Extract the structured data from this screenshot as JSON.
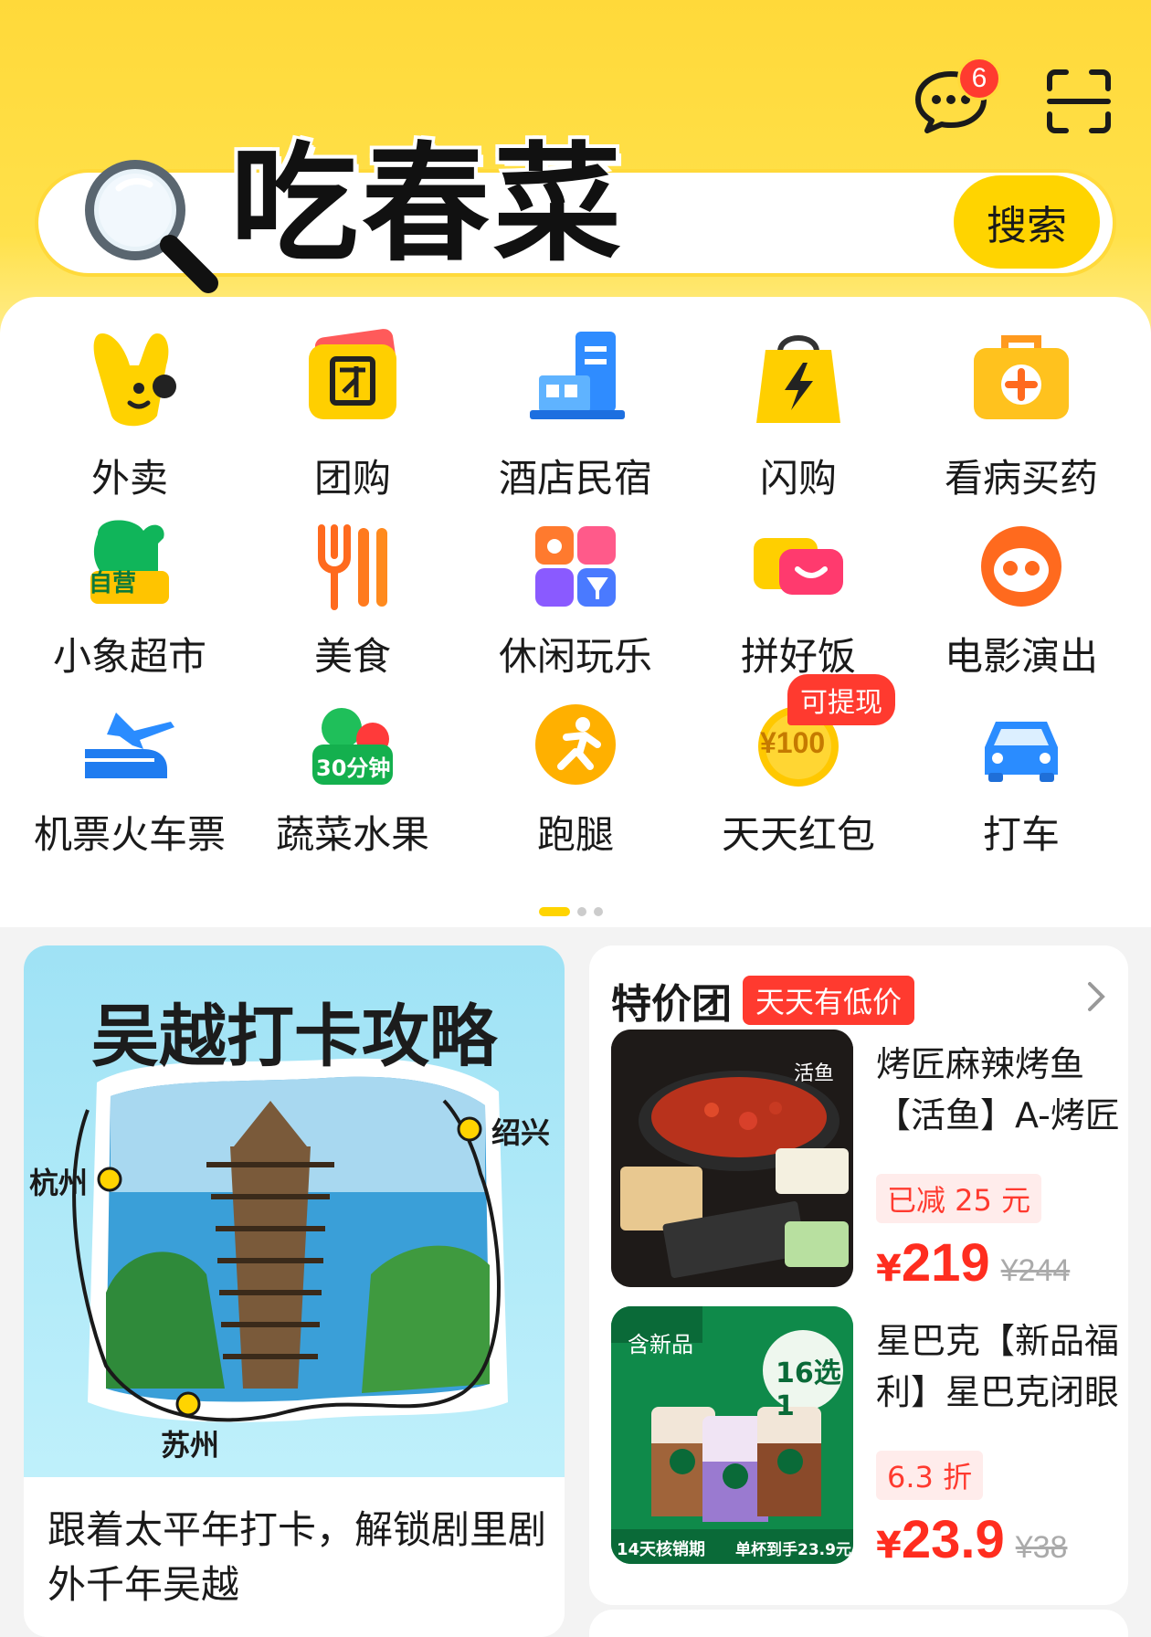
{
  "header": {
    "message_badge": "6",
    "icons": [
      "chat-icon",
      "scan-icon"
    ]
  },
  "search": {
    "query": "吃春菜",
    "button_label": "搜索"
  },
  "categories": [
    {
      "label": "外卖",
      "icon": "waimai-icon"
    },
    {
      "label": "团购",
      "icon": "tuangou-icon"
    },
    {
      "label": "酒店民宿",
      "icon": "hotel-icon"
    },
    {
      "label": "闪购",
      "icon": "flash-buy-icon"
    },
    {
      "label": "看病买药",
      "icon": "medicine-icon"
    },
    {
      "label": "小象超市",
      "icon": "elephant-market-icon",
      "sub": "自营"
    },
    {
      "label": "美食",
      "icon": "food-icon"
    },
    {
      "label": "休闲玩乐",
      "icon": "leisure-icon"
    },
    {
      "label": "拼好饭",
      "icon": "pinhaofan-icon"
    },
    {
      "label": "电影演出",
      "icon": "movie-icon"
    },
    {
      "label": "机票火车票",
      "icon": "ticket-icon"
    },
    {
      "label": "蔬菜水果",
      "icon": "vegetable-icon",
      "sub": "30分钟"
    },
    {
      "label": "跑腿",
      "icon": "errand-icon"
    },
    {
      "label": "天天红包",
      "icon": "red-packet-icon",
      "sub": "¥100",
      "tag": "可提现"
    },
    {
      "label": "打车",
      "icon": "taxi-icon"
    }
  ],
  "banner": {
    "title": "吴越打卡攻略",
    "cities": [
      "杭州",
      "绍兴",
      "苏州"
    ],
    "description": "跟着太平年打卡，解锁剧里剧外千年吴越"
  },
  "deals": {
    "title": "特价团",
    "tag": "天天有低价",
    "items": [
      {
        "name": "烤匠麻辣烤鱼【活鱼】A-烤匠",
        "discount": "已减 25 元",
        "currency": "¥",
        "price": "219",
        "old_price": "¥244",
        "thumb_tag": "活鱼"
      },
      {
        "name": "星巴克【新品福利】星巴克闭眼",
        "discount": "6.3 折",
        "currency": "¥",
        "price": "23.9",
        "old_price": "¥38",
        "thumb_tag": "含新品",
        "thumb_badge": "16选1",
        "thumb_footer_left": "14天核销期",
        "thumb_footer_right": "单杯到手23.9元"
      }
    ]
  },
  "colors": {
    "brand_yellow": "#ffd400",
    "accent_red": "#ff3a2f"
  }
}
